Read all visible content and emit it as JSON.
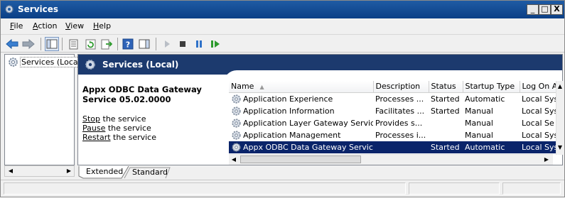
{
  "window": {
    "title": "Services",
    "minimize_label": "_",
    "maximize_label": "□",
    "close_label": "X"
  },
  "menu": {
    "file": "File",
    "action": "Action",
    "view": "View",
    "help": "Help"
  },
  "toolbar": {
    "icons": [
      "back-arrow-icon",
      "forward-arrow-icon",
      "show-hide-console-tree-icon",
      "properties-icon",
      "refresh-icon",
      "export-list-icon",
      "help-icon",
      "show-hide-action-pane-icon",
      "start-service-icon",
      "stop-service-icon",
      "pause-service-icon",
      "restart-service-icon"
    ]
  },
  "tree": {
    "root_label": "Services (Local)"
  },
  "panel": {
    "header": "Services (Local)"
  },
  "description": {
    "service_name": "Appx ODBC Data Gateway Service 05.02.0000",
    "stop_link": "Stop",
    "stop_rest": " the service",
    "pause_link": "Pause",
    "pause_rest": " the service",
    "restart_link": "Restart",
    "restart_rest": " the service"
  },
  "table": {
    "columns": [
      "Name",
      "Description",
      "Status",
      "Startup Type",
      "Log On As"
    ],
    "rows": [
      {
        "name": "Application Experience",
        "description": "Processes ...",
        "status": "Started",
        "startup": "Automatic",
        "logon": "Local Sys"
      },
      {
        "name": "Application Information",
        "description": "Facilitates ...",
        "status": "Started",
        "startup": "Manual",
        "logon": "Local Sys"
      },
      {
        "name": "Application Layer Gateway Service",
        "description": "Provides s...",
        "status": "",
        "startup": "Manual",
        "logon": "Local Se"
      },
      {
        "name": "Application Management",
        "description": "Processes i...",
        "status": "",
        "startup": "Manual",
        "logon": "Local Sys"
      },
      {
        "name": "Appx ODBC Data Gateway Service...",
        "description": "",
        "status": "Started",
        "startup": "Automatic",
        "logon": "Local Sys"
      }
    ],
    "selected_row_index": 4
  },
  "tabs": {
    "extended": "Extended",
    "standard": "Standard"
  },
  "colors": {
    "title_bar": "#0b3f86",
    "panel_header": "#1c3a6e",
    "selection": "#0a246a"
  }
}
